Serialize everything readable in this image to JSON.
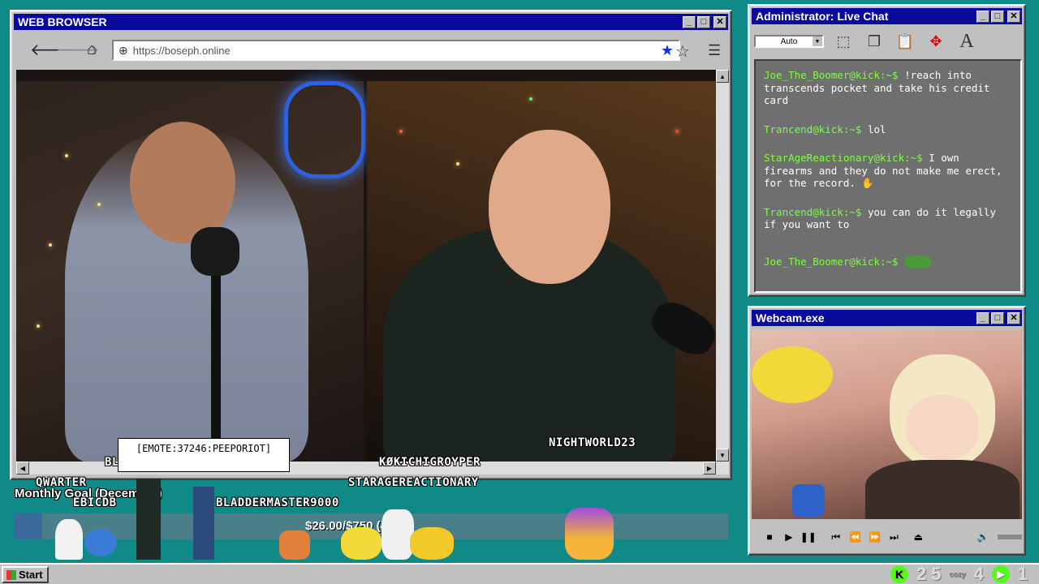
{
  "browser": {
    "title": "WEB BROWSER",
    "url": "https://boseph.online"
  },
  "stream": {
    "names": {
      "nightworld": "NIGHTWORLD23",
      "kochi": "KØKICHIGROYPER",
      "qwarter": "QWARTER",
      "starage": "STARAGEREACTIONARY",
      "ebicdb": "EBICDB",
      "bladder": "BLADDERMASTER9000",
      "partial": "BL"
    },
    "emote_tooltip": "[EMOTE:37246:PEEPORIOT]",
    "goal": {
      "label": "Monthly Goal (December)",
      "amount_text": "$26.00/$750 (4%)",
      "percent": 4
    }
  },
  "chat": {
    "title": "Administrator: Live Chat",
    "select_value": "Auto",
    "messages": [
      {
        "user": "Joe_The_Boomer@kick:~$",
        "text": " !reach into transcends pocket and take his credit card"
      },
      {
        "user": "Trancend@kick:~$",
        "text": " lol"
      },
      {
        "user": "StarAgeReactionary@kick:~$",
        "text": " I own firearms and they do not make me erect, for the record. ✋"
      },
      {
        "user": "Trancend@kick:~$",
        "text": " you can do it legally if you want to"
      },
      {
        "user": "Joe_The_Boomer@kick:~$",
        "text": ""
      }
    ]
  },
  "webcam": {
    "title": "Webcam.exe"
  },
  "taskbar": {
    "start_label": "Start",
    "tray_value_1": "2 5",
    "tray_value_2": "4",
    "tray_value_3": "1"
  },
  "colors": {
    "desktop": "#0f8a86",
    "titlebar": "#0a0a9c",
    "chat_user": "#7dff3c",
    "kick_green": "#53fc18"
  }
}
